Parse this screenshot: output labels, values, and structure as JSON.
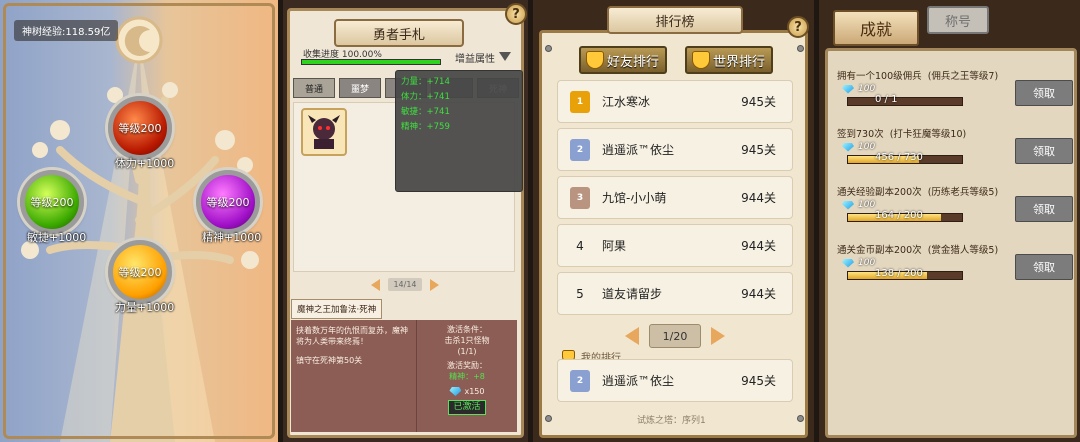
{
  "tree": {
    "exp_label": "神树经验:118.59亿",
    "nodes": [
      {
        "orb": "等级200",
        "label": "体力+1000",
        "color": "#b81800"
      },
      {
        "orb": "等级200",
        "label": "敏捷+1000",
        "color": "#3caa00"
      },
      {
        "orb": "等级200",
        "label": "精神+1000",
        "color": "#a010c8"
      },
      {
        "orb": "等级200",
        "label": "力量+1000",
        "color": "#ffa000"
      }
    ]
  },
  "handbook": {
    "title": "勇者手札",
    "progress_label": "收集进度 100.00%",
    "progress_value": 1.0,
    "buff_label": "增益属性",
    "tabs": [
      "普通",
      "噩梦",
      "",
      "",
      "死神"
    ],
    "buffs": [
      "力量：+714",
      "体力：+741",
      "敏捷：+741",
      "精神：+759"
    ],
    "page": "14/14",
    "skill_name": "魔神之王加鲁法·死神",
    "desc": "挟着数万年的仇恨而复苏，魔神将为人类带来终焉！",
    "location": "镇守在死神第50关",
    "cond_title": "激活条件：",
    "cond_value": "击杀1只怪物",
    "cond_progress": "(1/1)",
    "reward_title": "激活奖励：",
    "reward_value": "精神：+8",
    "gem_count": "x150",
    "status": "已激活"
  },
  "ranking": {
    "title": "排行榜",
    "tabs": [
      "好友排行",
      "世界排行"
    ],
    "rows": [
      {
        "rank": "1",
        "name": "江水寒冰",
        "value": "945关"
      },
      {
        "rank": "2",
        "name": "逍遥派™依尘",
        "value": "945关"
      },
      {
        "rank": "3",
        "name": "九馆-小小萌",
        "value": "944关"
      },
      {
        "rank": "4",
        "name": "阿果",
        "value": "944关"
      },
      {
        "rank": "5",
        "name": "道友请留步",
        "value": "944关"
      }
    ],
    "page": "1/20",
    "my_rank_label": "我的排行",
    "my_row": {
      "rank": "2",
      "name": "逍遥派™依尘",
      "value": "945关"
    },
    "footer": "试炼之塔：序列1"
  },
  "achievements": {
    "tab_active": "成就",
    "tab_inactive": "称号",
    "items": [
      {
        "title": "拥有一个100级佣兵",
        "sub": "(佣兵之王等级7)",
        "reward": "100",
        "count": "0 / 1",
        "fraction": 0.0,
        "button": "领取"
      },
      {
        "title": "签到730次",
        "sub": "(打卡狂魔等级10)",
        "reward": "100",
        "count": "456 / 730",
        "fraction": 0.62,
        "button": "领取"
      },
      {
        "title": "通关经验副本200次",
        "sub": "(历练老兵等级5)",
        "reward": "100",
        "count": "164 / 200",
        "fraction": 0.82,
        "button": "领取"
      },
      {
        "title": "通关金币副本200次",
        "sub": "(赏金猎人等级5)",
        "reward": "100",
        "count": "138 / 200",
        "fraction": 0.69,
        "button": "领取"
      }
    ]
  }
}
